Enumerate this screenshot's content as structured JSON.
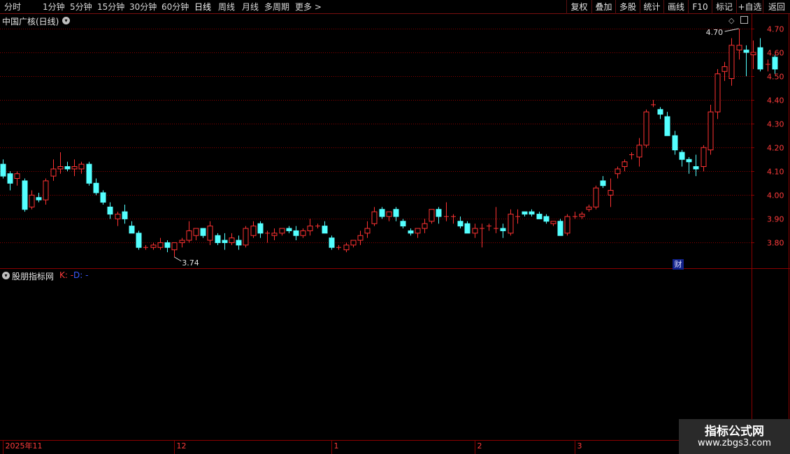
{
  "toolbar": {
    "periods": [
      "分时",
      "1分钟",
      "5分钟",
      "15分钟",
      "30分钟",
      "60分钟",
      "日线",
      "周线",
      "月线",
      "多周期",
      "更多 >"
    ],
    "active_period": "日线",
    "right_buttons": [
      "复权",
      "叠加",
      "多股",
      "统计",
      "画线",
      "F10",
      "标记",
      "+自选",
      "返回"
    ]
  },
  "main_chart": {
    "title": "中国广核(日线)",
    "high_label": "4.70",
    "low_label": "3.74",
    "event_badge": "财"
  },
  "indicator": {
    "title": "股朋指标网",
    "k_label": "K: -",
    "d_label": "D: -"
  },
  "watermark": {
    "line1": "指标公式网",
    "line2": "www.zbgs3.com"
  },
  "colors": {
    "up": "#ff3232",
    "down": "#54ffff",
    "grid": "#8b0000",
    "axis_text": "#ff3b3b"
  },
  "chart_data": {
    "type": "candlestick",
    "y_ticks": [
      "4.70",
      "4.60",
      "4.50",
      "4.40",
      "4.30",
      "4.20",
      "4.10",
      "4.00",
      "3.90",
      "3.80"
    ],
    "x_labels": [
      {
        "label": "2025年11",
        "index": 0
      },
      {
        "label": "12",
        "index": 24
      },
      {
        "label": "1",
        "index": 46
      },
      {
        "label": "2",
        "index": 66
      },
      {
        "label": "3",
        "index": 80
      }
    ],
    "ohlc": [
      [
        4.13,
        4.15,
        4.07,
        4.08
      ],
      [
        4.09,
        4.1,
        4.02,
        4.05
      ],
      [
        4.07,
        4.1,
        4.04,
        4.09
      ],
      [
        4.06,
        4.07,
        3.93,
        3.94
      ],
      [
        3.95,
        4.02,
        3.94,
        4.0
      ],
      [
        3.99,
        4.01,
        3.97,
        3.98
      ],
      [
        3.98,
        4.07,
        3.96,
        4.06
      ],
      [
        4.08,
        4.15,
        4.06,
        4.11
      ],
      [
        4.11,
        4.18,
        4.09,
        4.12
      ],
      [
        4.12,
        4.14,
        4.1,
        4.11
      ],
      [
        4.11,
        4.15,
        4.08,
        4.12
      ],
      [
        4.11,
        4.14,
        4.09,
        4.13
      ],
      [
        4.13,
        4.14,
        4.04,
        4.05
      ],
      [
        4.05,
        4.07,
        4.0,
        4.01
      ],
      [
        4.01,
        4.02,
        3.96,
        3.97
      ],
      [
        3.95,
        3.97,
        3.9,
        3.92
      ],
      [
        3.9,
        3.93,
        3.87,
        3.92
      ],
      [
        3.93,
        3.96,
        3.88,
        3.9
      ],
      [
        3.87,
        3.89,
        3.84,
        3.84
      ],
      [
        3.84,
        3.85,
        3.77,
        3.78
      ],
      [
        3.78,
        3.79,
        3.77,
        3.78
      ],
      [
        3.78,
        3.8,
        3.77,
        3.79
      ],
      [
        3.78,
        3.82,
        3.77,
        3.8
      ],
      [
        3.8,
        3.81,
        3.76,
        3.78
      ],
      [
        3.77,
        3.8,
        3.74,
        3.8
      ],
      [
        3.8,
        3.82,
        3.78,
        3.81
      ],
      [
        3.81,
        3.89,
        3.8,
        3.85
      ],
      [
        3.83,
        3.85,
        3.81,
        3.86
      ],
      [
        3.86,
        3.86,
        3.82,
        3.83
      ],
      [
        3.81,
        3.89,
        3.79,
        3.87
      ],
      [
        3.83,
        3.84,
        3.79,
        3.8
      ],
      [
        3.81,
        3.84,
        3.77,
        3.8
      ],
      [
        3.8,
        3.84,
        3.79,
        3.82
      ],
      [
        3.81,
        3.83,
        3.77,
        3.79
      ],
      [
        3.79,
        3.87,
        3.78,
        3.86
      ],
      [
        3.83,
        3.89,
        3.82,
        3.87
      ],
      [
        3.88,
        3.89,
        3.82,
        3.84
      ],
      [
        3.84,
        3.85,
        3.8,
        3.84
      ],
      [
        3.83,
        3.86,
        3.81,
        3.84
      ],
      [
        3.84,
        3.86,
        3.83,
        3.86
      ],
      [
        3.86,
        3.87,
        3.84,
        3.85
      ],
      [
        3.85,
        3.87,
        3.81,
        3.83
      ],
      [
        3.83,
        3.86,
        3.82,
        3.85
      ],
      [
        3.85,
        3.9,
        3.83,
        3.87
      ],
      [
        3.87,
        3.88,
        3.86,
        3.87
      ],
      [
        3.87,
        3.89,
        3.84,
        3.84
      ],
      [
        3.82,
        3.83,
        3.77,
        3.78
      ],
      [
        3.78,
        3.79,
        3.77,
        3.78
      ],
      [
        3.77,
        3.8,
        3.76,
        3.79
      ],
      [
        3.79,
        3.81,
        3.78,
        3.81
      ],
      [
        3.81,
        3.85,
        3.79,
        3.83
      ],
      [
        3.84,
        3.89,
        3.82,
        3.86
      ],
      [
        3.88,
        3.95,
        3.87,
        3.93
      ],
      [
        3.94,
        3.95,
        3.9,
        3.91
      ],
      [
        3.91,
        3.93,
        3.89,
        3.93
      ],
      [
        3.94,
        3.95,
        3.89,
        3.91
      ],
      [
        3.89,
        3.9,
        3.86,
        3.87
      ],
      [
        3.85,
        3.86,
        3.83,
        3.84
      ],
      [
        3.84,
        3.86,
        3.82,
        3.86
      ],
      [
        3.86,
        3.9,
        3.84,
        3.88
      ],
      [
        3.89,
        3.94,
        3.88,
        3.94
      ],
      [
        3.94,
        3.95,
        3.88,
        3.91
      ],
      [
        3.91,
        3.97,
        3.89,
        3.91
      ],
      [
        3.91,
        3.92,
        3.88,
        3.91
      ],
      [
        3.89,
        3.91,
        3.86,
        3.87
      ],
      [
        3.88,
        3.89,
        3.84,
        3.84
      ],
      [
        3.84,
        3.88,
        3.82,
        3.86
      ],
      [
        3.86,
        3.88,
        3.78,
        3.86
      ],
      [
        3.87,
        3.88,
        3.85,
        3.87
      ],
      [
        3.86,
        3.95,
        3.84,
        3.86
      ],
      [
        3.86,
        3.88,
        3.82,
        3.85
      ],
      [
        3.84,
        3.94,
        3.83,
        3.92
      ],
      [
        3.91,
        3.94,
        3.88,
        3.91
      ],
      [
        3.93,
        3.93,
        3.91,
        3.92
      ],
      [
        3.93,
        3.94,
        3.91,
        3.92
      ],
      [
        3.92,
        3.93,
        3.9,
        3.9
      ],
      [
        3.91,
        3.92,
        3.88,
        3.89
      ],
      [
        3.88,
        3.89,
        3.87,
        3.89
      ],
      [
        3.89,
        3.9,
        3.83,
        3.83
      ],
      [
        3.84,
        3.92,
        3.83,
        3.91
      ],
      [
        3.91,
        3.93,
        3.9,
        3.91
      ],
      [
        3.91,
        3.93,
        3.9,
        3.92
      ],
      [
        3.94,
        3.96,
        3.93,
        3.95
      ],
      [
        3.95,
        4.04,
        3.94,
        4.03
      ],
      [
        4.06,
        4.08,
        4.03,
        4.04
      ],
      [
        4.0,
        4.07,
        3.95,
        4.02
      ],
      [
        4.09,
        4.12,
        4.07,
        4.11
      ],
      [
        4.12,
        4.15,
        4.1,
        4.14
      ],
      [
        4.17,
        4.18,
        4.15,
        4.17
      ],
      [
        4.16,
        4.24,
        4.12,
        4.21
      ],
      [
        4.21,
        4.36,
        4.2,
        4.35
      ],
      [
        4.38,
        4.4,
        4.37,
        4.38
      ],
      [
        4.36,
        4.37,
        4.32,
        4.34
      ],
      [
        4.33,
        4.35,
        4.25,
        4.25
      ],
      [
        4.25,
        4.27,
        4.17,
        4.19
      ],
      [
        4.18,
        4.19,
        4.12,
        4.15
      ],
      [
        4.15,
        4.16,
        4.09,
        4.14
      ],
      [
        4.12,
        4.17,
        4.08,
        4.11
      ],
      [
        4.12,
        4.21,
        4.1,
        4.2
      ],
      [
        4.19,
        4.38,
        4.17,
        4.35
      ],
      [
        4.35,
        4.53,
        4.32,
        4.51
      ],
      [
        4.52,
        4.56,
        4.48,
        4.54
      ],
      [
        4.49,
        4.66,
        4.46,
        4.63
      ],
      [
        4.61,
        4.7,
        4.57,
        4.63
      ],
      [
        4.61,
        4.63,
        4.5,
        4.6
      ],
      [
        4.59,
        4.65,
        4.53,
        4.6
      ],
      [
        4.62,
        4.66,
        4.52,
        4.53
      ],
      [
        4.55,
        4.57,
        4.52,
        4.55
      ],
      [
        4.58,
        4.59,
        4.51,
        4.53
      ]
    ]
  }
}
